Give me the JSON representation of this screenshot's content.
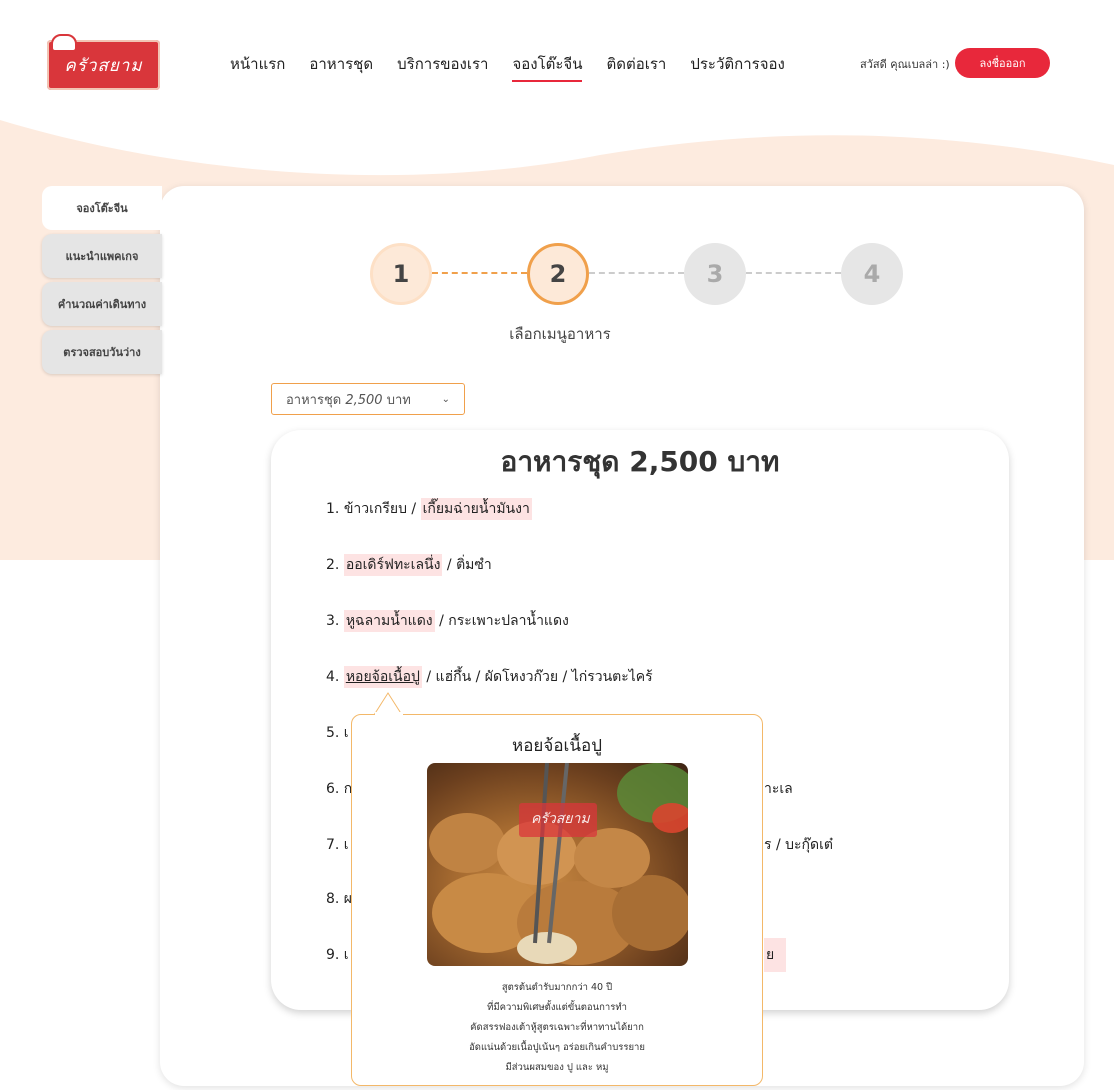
{
  "brand": {
    "logo_text": "ครัวสยาม"
  },
  "nav": {
    "items": [
      {
        "label": "หน้าแรก",
        "active": false
      },
      {
        "label": "อาหารชุด",
        "active": false
      },
      {
        "label": "บริการของเรา",
        "active": false
      },
      {
        "label": "จองโต๊ะจีน",
        "active": true
      },
      {
        "label": "ติดต่อเรา",
        "active": false
      },
      {
        "label": "ประวัติการจอง",
        "active": false
      }
    ],
    "greeting": "สวัสดี คุณเบลล่า :)",
    "logout_label": "ลงชื่อออก"
  },
  "side_tabs": [
    {
      "label": "จองโต๊ะจีน",
      "active": true
    },
    {
      "label": "แนะนำแพคเกจ",
      "active": false
    },
    {
      "label": "คำนวณค่าเดินทาง",
      "active": false
    },
    {
      "label": "ตรวจสอบวันว่าง",
      "active": false
    }
  ],
  "stepper": {
    "steps": [
      "1",
      "2",
      "3",
      "4"
    ],
    "current": 2,
    "current_label": "เลือกเมนูอาหาร"
  },
  "set_select": {
    "value_prefix": "อาหารชุด ",
    "value_amount": "2,500",
    "value_suffix": " บาท"
  },
  "menu": {
    "title": "อาหารชุด 2,500 บาท",
    "items": [
      {
        "num": "1.",
        "a": "ข้าวเกรียบ / ",
        "b": "เกี๊ยมฉ่ายน้ำมันงา",
        "c": ""
      },
      {
        "num": "2.",
        "a": "",
        "b": "ออเดิร์ฟทะเลนึ่ง",
        "c": " / ติ่มซำ"
      },
      {
        "num": "3.",
        "a": "",
        "b": "หูฉลามน้ำแดง",
        "c": " / กระเพาะปลาน้ำแดง"
      },
      {
        "num": "4.",
        "a": "",
        "b": "หอยจ้อเนื้อปู",
        "c": " / แฮ่กึ้น / ผัดโหงวก๊วย / ไก่รวนตะไคร้"
      },
      {
        "num": "5. เ",
        "a": "",
        "b": "",
        "c": ""
      },
      {
        "num": "6. ก",
        "a": "",
        "b": "",
        "c": ""
      },
      {
        "num": "7. เ",
        "a": "",
        "b": "",
        "c": ""
      },
      {
        "num": "8. ผ",
        "a": "",
        "b": "",
        "c": ""
      },
      {
        "num": "9. เ",
        "a": "",
        "b": "",
        "c": ""
      }
    ],
    "tails": {
      "row6": "าะเล",
      "row7": "ร / บะกุ๊ดเต๋",
      "row9": "ย"
    }
  },
  "popup": {
    "title": "หอยจ้อเนื้อปู",
    "image_label": "ครัวสยาม",
    "desc": [
      "สูตรต้นตำรับมากกว่า 40 ปี",
      "ที่มีความพิเศษตั้งแต่ขั้นตอนการทำ",
      "คัดสรรฟองเต้าหู้สูตรเฉพาะที่หาทานได้ยาก",
      "อัดแน่นด้วยเนื้อปูเน้นๆ อร่อยเกินคำบรรยาย",
      "มีส่วนผสมของ ปู และ หมู"
    ]
  },
  "colors": {
    "accent": "#e8283b",
    "orange": "#f0a04b",
    "peach": "#fde9d8",
    "highlight": "#fde3e3"
  }
}
